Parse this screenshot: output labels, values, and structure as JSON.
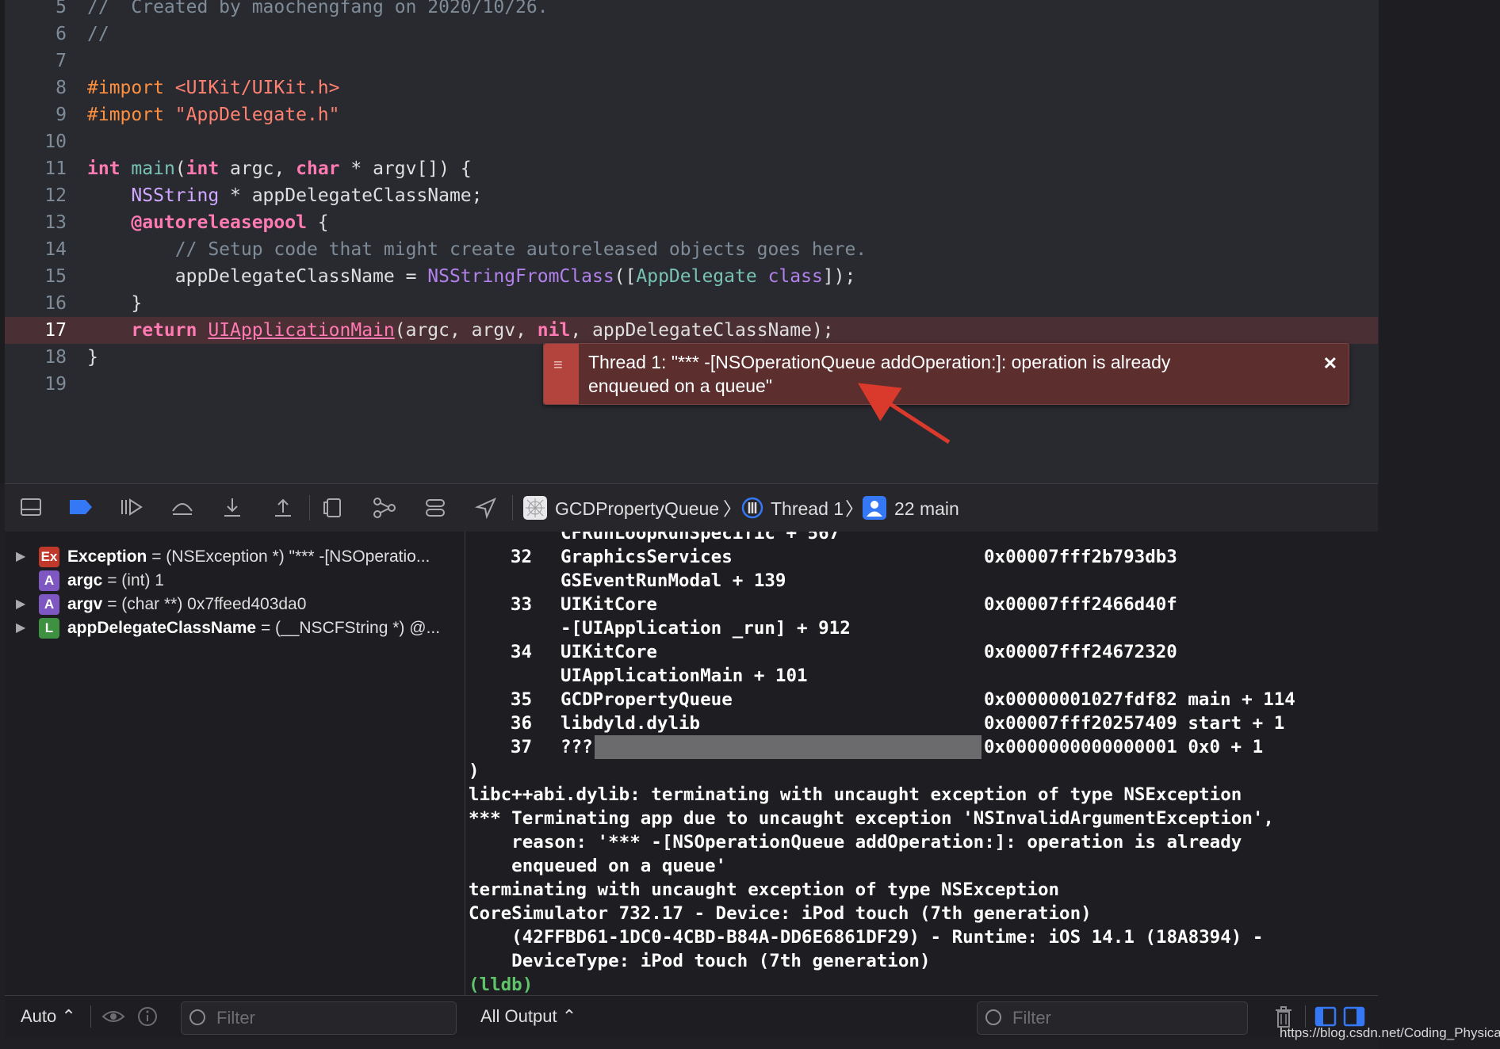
{
  "editor": {
    "lines": [
      {
        "num": "5",
        "tokens": [
          {
            "t": "//  Created by maochengfang on 2020/10/26.",
            "c": "k-com"
          }
        ]
      },
      {
        "num": "6",
        "tokens": [
          {
            "t": "//",
            "c": "k-com"
          }
        ]
      },
      {
        "num": "7",
        "tokens": []
      },
      {
        "num": "8",
        "tokens": [
          {
            "t": "#import ",
            "c": "k-pre"
          },
          {
            "t": "<UIKit/UIKit.h>",
            "c": "k-str"
          }
        ]
      },
      {
        "num": "9",
        "tokens": [
          {
            "t": "#import ",
            "c": "k-pre"
          },
          {
            "t": "\"AppDelegate.h\"",
            "c": "k-str"
          }
        ]
      },
      {
        "num": "10",
        "tokens": []
      },
      {
        "num": "11",
        "tokens": [
          {
            "t": "int",
            "c": "k-kw"
          },
          {
            "t": " "
          },
          {
            "t": "main",
            "c": "k-fn"
          },
          {
            "t": "("
          },
          {
            "t": "int",
            "c": "k-kw"
          },
          {
            "t": " argc, "
          },
          {
            "t": "char",
            "c": "k-kw"
          },
          {
            "t": " * argv[]) {"
          }
        ]
      },
      {
        "num": "12",
        "tokens": [
          {
            "t": "    "
          },
          {
            "t": "NSString",
            "c": "k-type"
          },
          {
            "t": " * appDelegateClassName;"
          }
        ]
      },
      {
        "num": "13",
        "tokens": [
          {
            "t": "    "
          },
          {
            "t": "@autoreleasepool",
            "c": "k-kw"
          },
          {
            "t": " {"
          }
        ]
      },
      {
        "num": "14",
        "tokens": [
          {
            "t": "        "
          },
          {
            "t": "// Setup code that might create autoreleased objects goes here.",
            "c": "k-com"
          }
        ]
      },
      {
        "num": "15",
        "tokens": [
          {
            "t": "        appDelegateClassName = "
          },
          {
            "t": "NSStringFromClass",
            "c": "k-call"
          },
          {
            "t": "(["
          },
          {
            "t": "AppDelegate",
            "c": "k-fn"
          },
          {
            "t": " "
          },
          {
            "t": "class",
            "c": "k-call"
          },
          {
            "t": "]);"
          }
        ]
      },
      {
        "num": "16",
        "tokens": [
          {
            "t": "    }"
          }
        ]
      },
      {
        "num": "17",
        "current": true,
        "tokens": [
          {
            "t": "    "
          },
          {
            "t": "return",
            "c": "k-kw"
          },
          {
            "t": " "
          },
          {
            "t": "UIApplicationMain",
            "c": "k-link"
          },
          {
            "t": "(argc, argv, "
          },
          {
            "t": "nil",
            "c": "k-kw"
          },
          {
            "t": ", appDelegateClassName);"
          }
        ]
      },
      {
        "num": "18",
        "tokens": [
          {
            "t": "}"
          }
        ]
      },
      {
        "num": "19",
        "tokens": []
      }
    ]
  },
  "error_banner": {
    "line1": "Thread 1: \"*** -[NSOperationQueue addOperation:]: operation is already",
    "line2": "enqueued on a queue\"",
    "menu_icon": "≡",
    "close_icon": "✕"
  },
  "debug_bar": {
    "crumbs": {
      "target": "GCDPropertyQueue",
      "thread": "Thread 1",
      "frame": "22 main"
    },
    "sep": "〉"
  },
  "variables": [
    {
      "badge": "Ex",
      "badge_color": "#c0392b",
      "expandable": true,
      "name": "Exception",
      "value": " = (NSException *) \"*** -[NSOperatio..."
    },
    {
      "badge": "A",
      "badge_color": "#7e57c2",
      "expandable": false,
      "name": "argc",
      "value": " = (int) 1"
    },
    {
      "badge": "A",
      "badge_color": "#7e57c2",
      "expandable": true,
      "name": "argv",
      "value": " = (char **) 0x7ffeed403da0"
    },
    {
      "badge": "L",
      "badge_color": "#3d9140",
      "expandable": true,
      "name": "appDelegateClassName",
      "value": " = (__NSCFString *) @..."
    }
  ],
  "console": {
    "partial_top": "CFRunLoopRunSpecific + 567",
    "frames": [
      {
        "num": "32",
        "lib": "GraphicsServices",
        "addr": "0x00007fff2b793db3",
        "sym": "GSEventRunModal + 139"
      },
      {
        "num": "33",
        "lib": "UIKitCore",
        "addr": "0x00007fff2466d40f",
        "sym": "-[UIApplication _run] + 912"
      },
      {
        "num": "34",
        "lib": "UIKitCore",
        "addr": "0x00007fff24672320",
        "sym": "UIApplicationMain + 101"
      },
      {
        "num": "35",
        "lib": "GCDPropertyQueue",
        "addr": "0x00000001027fdf82 main + 114",
        "sym": ""
      },
      {
        "num": "36",
        "lib": "libdyld.dylib",
        "addr": "0x00007fff20257409 start + 1",
        "sym": ""
      },
      {
        "num": "37",
        "lib": "???",
        "addr": "0x0000000000000001 0x0 + 1",
        "sym": ""
      }
    ],
    "tail": [
      ")",
      "libc++abi.dylib: terminating with uncaught exception of type NSException",
      "*** Terminating app due to uncaught exception 'NSInvalidArgumentException',",
      "    reason: '*** -[NSOperationQueue addOperation:]: operation is already",
      "    enqueued on a queue'",
      "terminating with uncaught exception of type NSException",
      "CoreSimulator 732.17 - Device: iPod touch (7th generation)",
      "    (42FFBD61-1DC0-4CBD-B84A-DD6E6861DF29) - Runtime: iOS 14.1 (18A8394) -",
      "    DeviceType: iPod touch (7th generation)"
    ],
    "prompt": "(lldb)"
  },
  "bottom_bar": {
    "scope": "Auto ⌃",
    "filter_placeholder": "Filter",
    "output": "All Output ⌃",
    "console_filter_placeholder": "Filter"
  },
  "watermark": "https://blog.csdn.net/Coding_Physical",
  "colors": {
    "accent_blue": "#3478f6",
    "error_red": "#b3443d",
    "arrow_red": "#d93a2b"
  }
}
